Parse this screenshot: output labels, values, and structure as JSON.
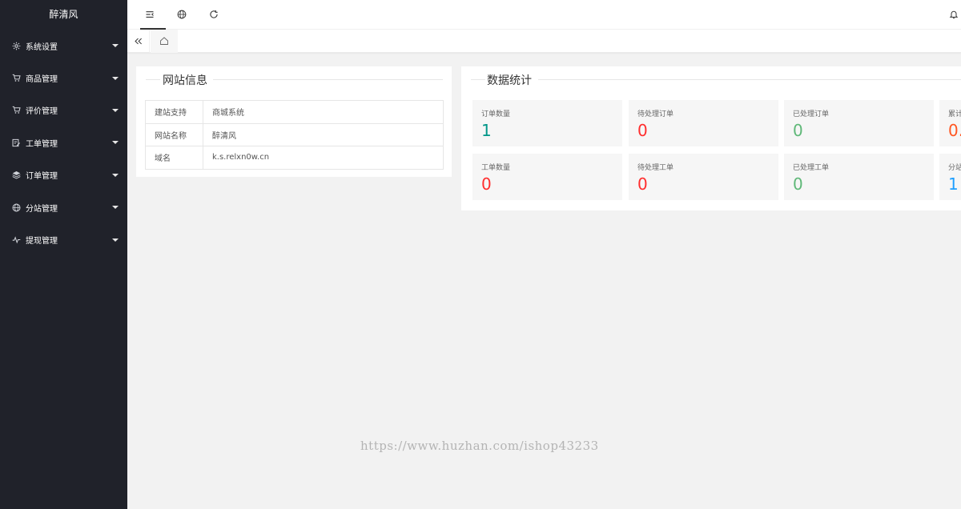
{
  "brand": "醉清风",
  "sidebar": {
    "items": [
      {
        "label": "系统设置",
        "icon": "gear-icon"
      },
      {
        "label": "商品管理",
        "icon": "cart-icon"
      },
      {
        "label": "评价管理",
        "icon": "cart-icon"
      },
      {
        "label": "工单管理",
        "icon": "edit-icon"
      },
      {
        "label": "订单管理",
        "icon": "layers-icon"
      },
      {
        "label": "分站管理",
        "icon": "globe-icon"
      },
      {
        "label": "提现管理",
        "icon": "pulse-icon"
      }
    ]
  },
  "header": {
    "icons": [
      "menu-fold-icon",
      "globe-icon",
      "refresh-icon",
      "bell-icon"
    ]
  },
  "tabs": {
    "prev_icon": "double-left-icon",
    "home_icon": "home-icon"
  },
  "site_info": {
    "title": "网站信息",
    "rows": [
      {
        "key": "建站支持",
        "value": "商城系统"
      },
      {
        "key": "网站名称",
        "value": "醉清风"
      },
      {
        "key": "域名",
        "value": "k.s.relxn0w.cn"
      }
    ]
  },
  "stats": {
    "title": "数据统计",
    "items": [
      {
        "label": "订单数量",
        "value": "1",
        "color": "#009688"
      },
      {
        "label": "待处理订单",
        "value": "0",
        "color": "#ff2e2e"
      },
      {
        "label": "已处理订单",
        "value": "0",
        "color": "#5fb878"
      },
      {
        "label": "累计",
        "value": "0.",
        "color": "#ff5722"
      },
      {
        "label": "工单数量",
        "value": "0",
        "color": "#ff2e2e"
      },
      {
        "label": "待处理工单",
        "value": "0",
        "color": "#ff2e2e"
      },
      {
        "label": "已处理工单",
        "value": "0",
        "color": "#5fb878"
      },
      {
        "label": "分站",
        "value": "1",
        "color": "#1e9fff"
      }
    ]
  },
  "watermark": "https://www.huzhan.com/ishop43233"
}
